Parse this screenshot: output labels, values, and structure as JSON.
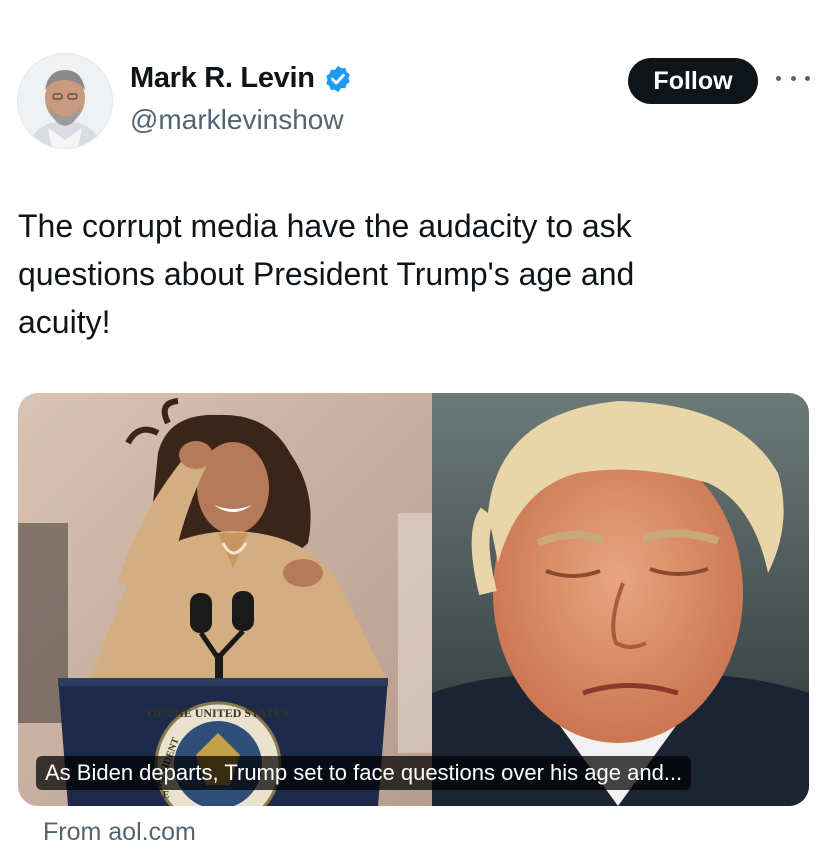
{
  "author": {
    "name": "Mark R. Levin",
    "handle": "@marklevinshow",
    "verified_color": "#1d9bf0"
  },
  "actions": {
    "follow_label": "Follow",
    "more_icon": "more-horizontal-icon"
  },
  "tweet": {
    "text": "The corrupt media have the audacity to ask\nquestions about President Trump's age and\nacuity!"
  },
  "link_card": {
    "caption": "As Biden departs, Trump set to face questions over his age and...",
    "source": "From aol.com",
    "seal_text": "OF THE UNITED STATES",
    "seal_text_side": "RESIDENT",
    "seal_text_prefix": "E"
  }
}
